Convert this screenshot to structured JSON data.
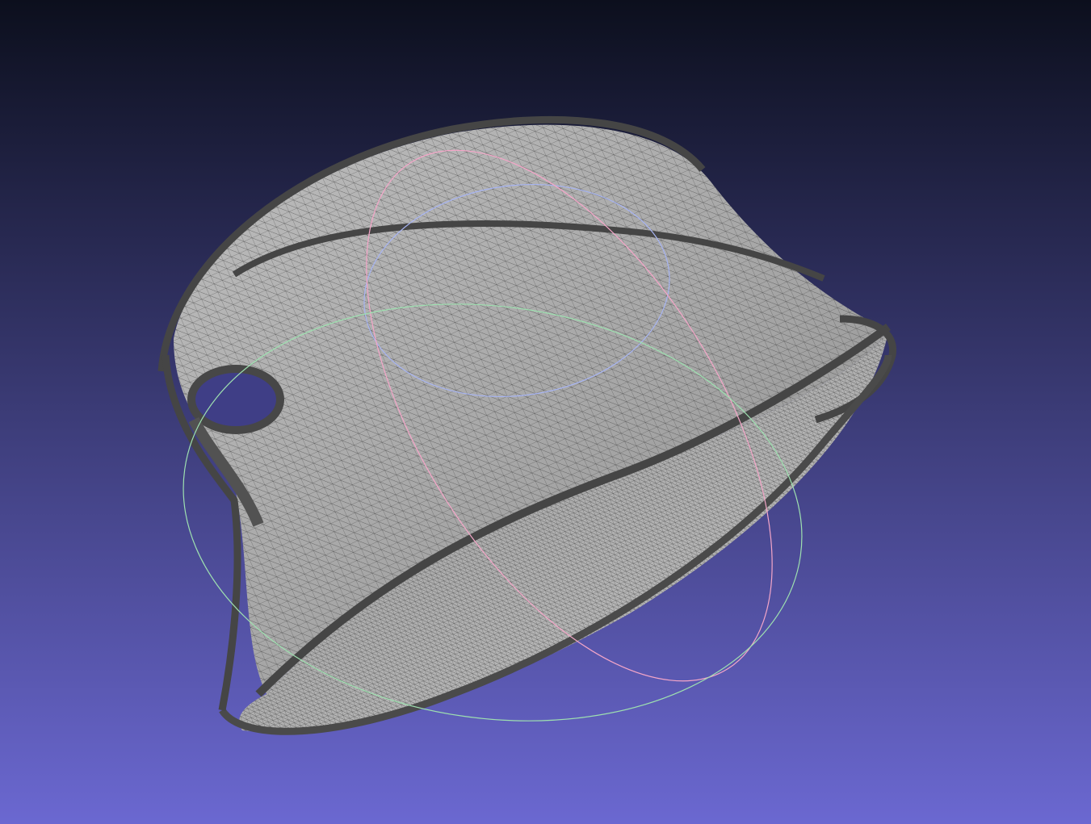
{
  "viewer": {
    "background": {
      "top": "#0c0f1d",
      "bottom": "#6b68d1"
    },
    "mesh": {
      "surface_color": "#a9a9a9",
      "edge_color": "#454545",
      "wire_color": "#2f2f2f",
      "render_mode": "wireframe-over-solid"
    },
    "trackball": {
      "visible": true,
      "ring_colors": {
        "x": "#f4a6c8",
        "y": "#9ee0b0",
        "z": "#a7b4f2"
      }
    }
  }
}
